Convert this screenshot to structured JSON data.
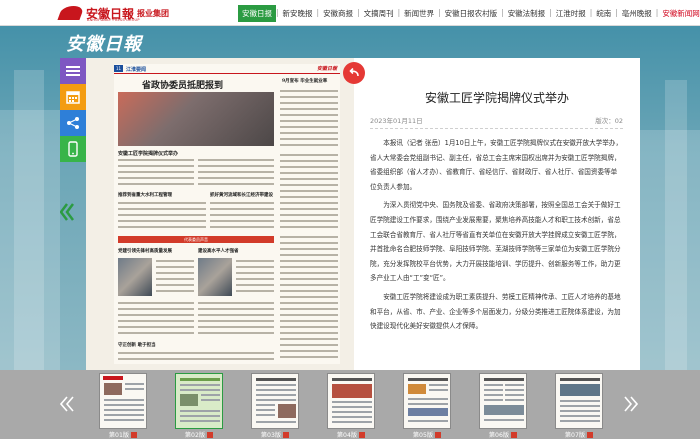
{
  "header": {
    "logo_text": "安徽日報",
    "logo_group": "报业集团",
    "logo_en": "ANHUI DAILY PRESS GROUP",
    "nav": [
      {
        "label": "安徽日报",
        "active": true
      },
      {
        "label": "新安晚报"
      },
      {
        "label": "安徽商报"
      },
      {
        "label": "文摘周刊"
      },
      {
        "label": "新闻世界"
      },
      {
        "label": "安徽日报农村版"
      },
      {
        "label": "安徽法制报"
      },
      {
        "label": "江淮时报"
      },
      {
        "label": "皖南"
      },
      {
        "label": "亳州晚报"
      },
      {
        "label": "安徽新闻网",
        "highlight": true
      }
    ]
  },
  "masthead": "安徽日報",
  "tools": [
    {
      "name": "list-icon",
      "color": "#7e57c2"
    },
    {
      "name": "calendar-icon",
      "color": "#f39c12"
    },
    {
      "name": "share-icon",
      "color": "#2e7fd8"
    },
    {
      "name": "mobile-icon",
      "color": "#38b449"
    }
  ],
  "newspaper": {
    "section_badge": "11",
    "section_title": "江淮要闻",
    "headline_main": "省政协委员抵肥报到",
    "headline_side": "9月宣布 毕业生就业率",
    "headline_2": "安徽工匠学院揭牌仪式举办",
    "headline_3": "推荐到省重大水利工程管理",
    "headline_4": "抓好黄河流域和长江经济带建设",
    "headline_5": "建设高水平人才强省",
    "red_band": "代表委员声音",
    "headline_6": "党建引领先锋村高质量发展",
    "headline_7": "守正创新 敢于担当"
  },
  "article": {
    "back_icon": "back-arrow-icon",
    "title": "安徽工匠学院揭牌仪式举办",
    "date": "2023年01月11日",
    "edition": "版次：02",
    "paragraphs": [
      "本报讯（记者 张岳）1月10日上午，安徽工匠学院揭牌仪式在安徽开放大学举办，省人大常委会党组副书记、副主任，省总工会主席宋国权出席并为安徽工匠学院揭牌，省委组织部（省人才办）、省教育厅、省经信厅、省财政厅、省人社厅、省国资委等单位负责人参加。",
      "为深入贯彻党中央、国务院及省委、省政府决策部署，按照全国总工会关于做好工匠学院建设工作要求，围绕产业发展需要，聚焦培养高技能人才和职工技术创新，省总工会联合省教育厅、省人社厅等省直有关单位在安徽开放大学挂牌成立安徽工匠学院，并首批命名合肥技师学院、阜阳技师学院、芜湖技师学院等三家单位为安徽工匠学院分院，充分发挥院校平台优势，大力开展技能培训、学历提升、创新服务等工作，助力更多产业工人由“工”变“匠”。",
      "安徽工匠学院将建设成为职工素质提升、劳模工匠精神传承、工匠人才培养的基地和平台，从省、市、产业、企业等多个层面发力，分级分类推进工匠院体系建设，为加快建设现代化美好安徽提供人才保障。"
    ]
  },
  "thumbnails": [
    {
      "label": "第01版",
      "selected": false
    },
    {
      "label": "第02版",
      "selected": true
    },
    {
      "label": "第03版",
      "selected": false
    },
    {
      "label": "第04版",
      "selected": false
    },
    {
      "label": "第05版",
      "selected": false
    },
    {
      "label": "第06版",
      "selected": false
    },
    {
      "label": "第07版",
      "selected": false
    }
  ],
  "icons": {
    "prev_page": "chevron-double-left-icon",
    "next_page": "chevron-double-right-icon"
  }
}
